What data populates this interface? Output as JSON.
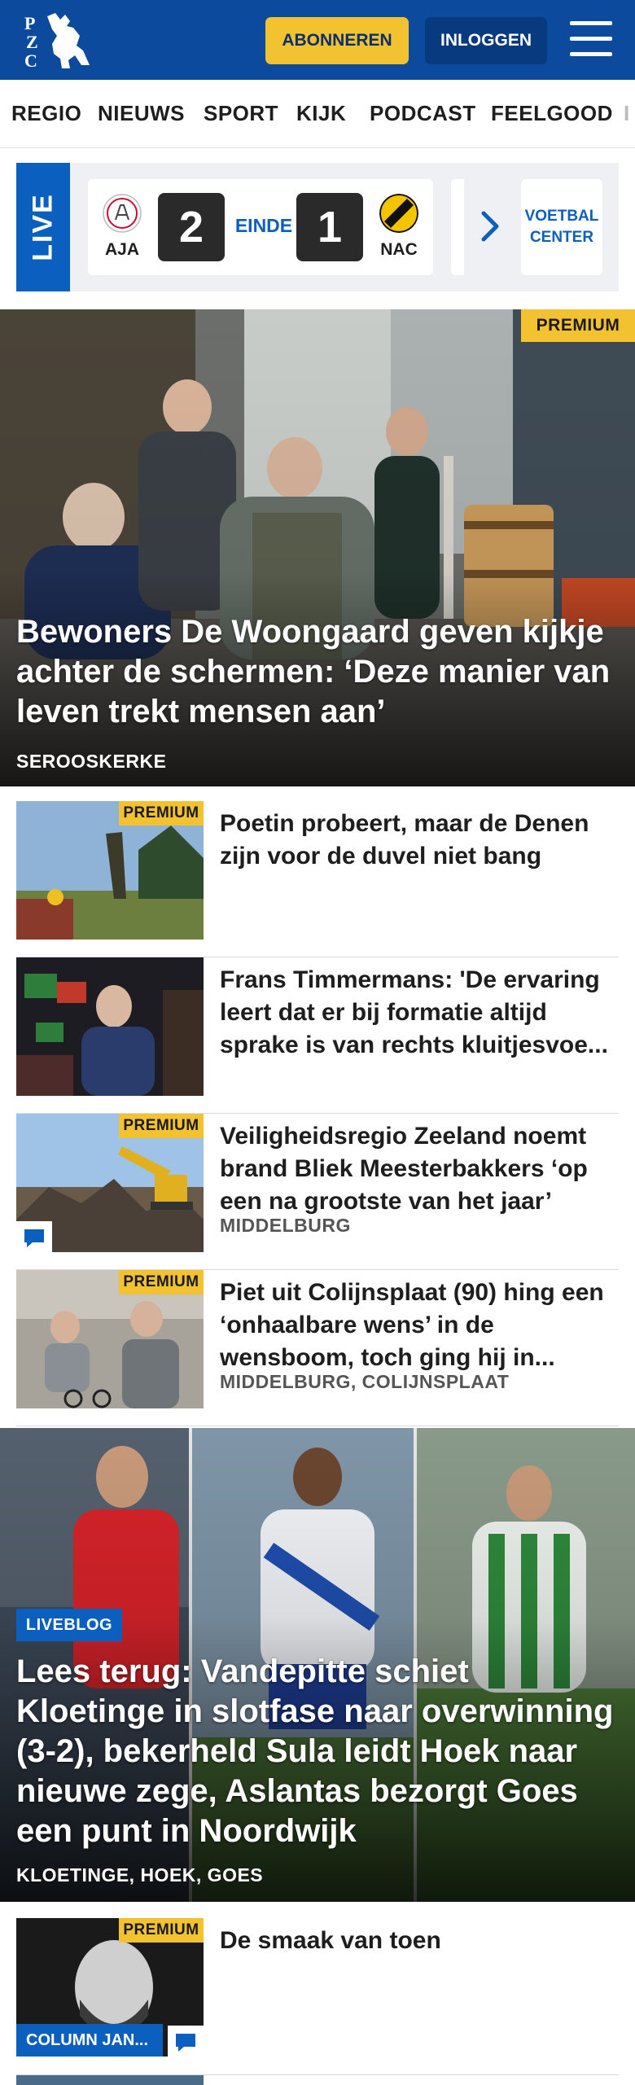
{
  "header": {
    "logo_text": "PZC",
    "subscribe_label": "ABONNEREN",
    "login_label": "INLOGGEN",
    "menu_icon": "hamburger-menu-icon"
  },
  "nav": {
    "items": [
      "REGIO",
      "NIEUWS",
      "SPORT",
      "KIJK",
      "PODCAST",
      "FEELGOOD",
      "I"
    ]
  },
  "scorebar": {
    "live_label": "LIVE",
    "match": {
      "home_team": "AJA",
      "home_score": "2",
      "status": "EINDE",
      "away_score": "1",
      "away_team": "NAC"
    },
    "center_label_line1": "VOETBAL",
    "center_label_line2": "CENTER"
  },
  "hero": {
    "badge": "PREMIUM",
    "title": "Bewoners De Woongaard geven kijkje achter de schermen: ‘Deze manier van leven trekt mensen aan’",
    "location": "SEROOSKERKE"
  },
  "articles": [
    {
      "badge": "PREMIUM",
      "title": "Poetin probeert, maar de Denen zijn voor de duvel niet bang",
      "location": ""
    },
    {
      "badge": "",
      "title": "Frans Timmermans: 'De ervaring leert dat er bij formatie altijd sprake is van rechts kluitjesvoe...",
      "location": ""
    },
    {
      "badge": "PREMIUM",
      "title": "Veiligheidsregio Zeeland noemt brand Bliek Meesterbakkers ‘op een na grootste van het jaar’",
      "location": "MIDDELBURG"
    },
    {
      "badge": "PREMIUM",
      "title": "Piet uit Colijnsplaat (90) hing een ‘onhaalbare wens’ in de wensboom, toch ging hij in...",
      "location": "MIDDELBURG, COLIJNSPLAAT"
    }
  ],
  "liveblog": {
    "badge": "LIVEBLOG",
    "title": "Lees terug: Vandepitte schiet Kloetinge in slotfase naar overwin­ning (3-2), bekerheld Sula leidt Hoek naar nieuwe zege, Aslantas bezorgt Goes een punt in Noordwijk",
    "location": "KLOETINGE, HOEK, GOES"
  },
  "column_article": {
    "badge": "PREMIUM",
    "tag": "COLUMN JAN...",
    "title": "De smaak van toen"
  },
  "colors": {
    "brand_blue": "#0b4a9c",
    "accent_blue": "#0b5fbf",
    "premium_yellow": "#f2c230"
  }
}
